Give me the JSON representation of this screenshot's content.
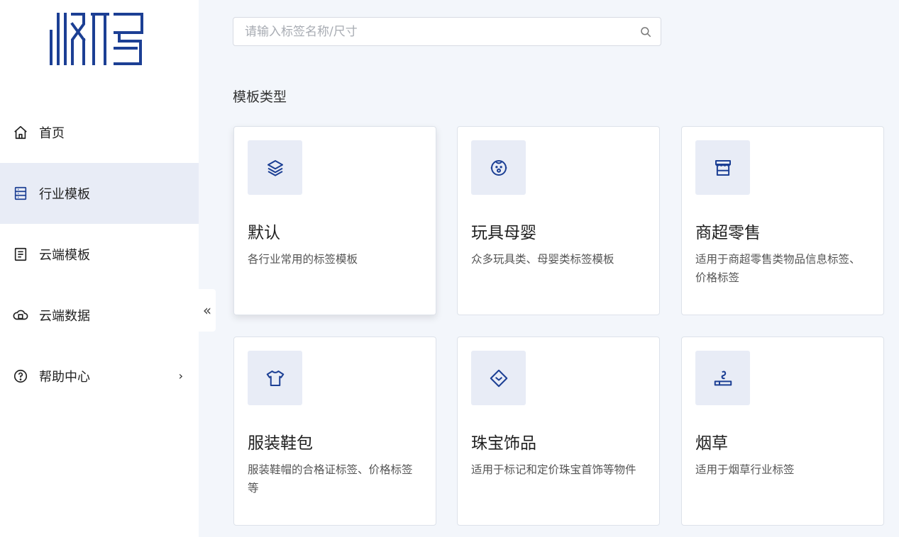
{
  "brand": {
    "logo_text": "版码",
    "accent": "#1c3f94"
  },
  "nav": {
    "items": [
      {
        "label": "首页",
        "icon": "home-icon"
      },
      {
        "label": "行业模板",
        "icon": "template-icon",
        "active": true
      },
      {
        "label": "云端模板",
        "icon": "cloud-template-icon"
      },
      {
        "label": "云端数据",
        "icon": "cloud-data-icon"
      },
      {
        "label": "帮助中心",
        "icon": "help-icon",
        "chevron": "›"
      }
    ]
  },
  "collapse_glyph": "«",
  "search": {
    "placeholder": "请输入标签名称/尺寸",
    "value": ""
  },
  "section_title": "模板类型",
  "cards": [
    {
      "name": "默认",
      "desc": "各行业常用的标签模板",
      "icon": "layers-icon"
    },
    {
      "name": "玩具母婴",
      "desc": "众多玩具类、母婴类标签模板",
      "icon": "baby-icon"
    },
    {
      "name": "商超零售",
      "desc": "适用于商超零售类物品信息标签、价格标签",
      "icon": "store-icon"
    },
    {
      "name": "服装鞋包",
      "desc": "服装鞋帽的合格证标签、价格标签等",
      "icon": "tshirt-icon"
    },
    {
      "name": "珠宝饰品",
      "desc": "适用于标记和定价珠宝首饰等物件",
      "icon": "diamond-icon"
    },
    {
      "name": "烟草",
      "desc": "适用于烟草行业标签",
      "icon": "cigarette-icon"
    }
  ]
}
